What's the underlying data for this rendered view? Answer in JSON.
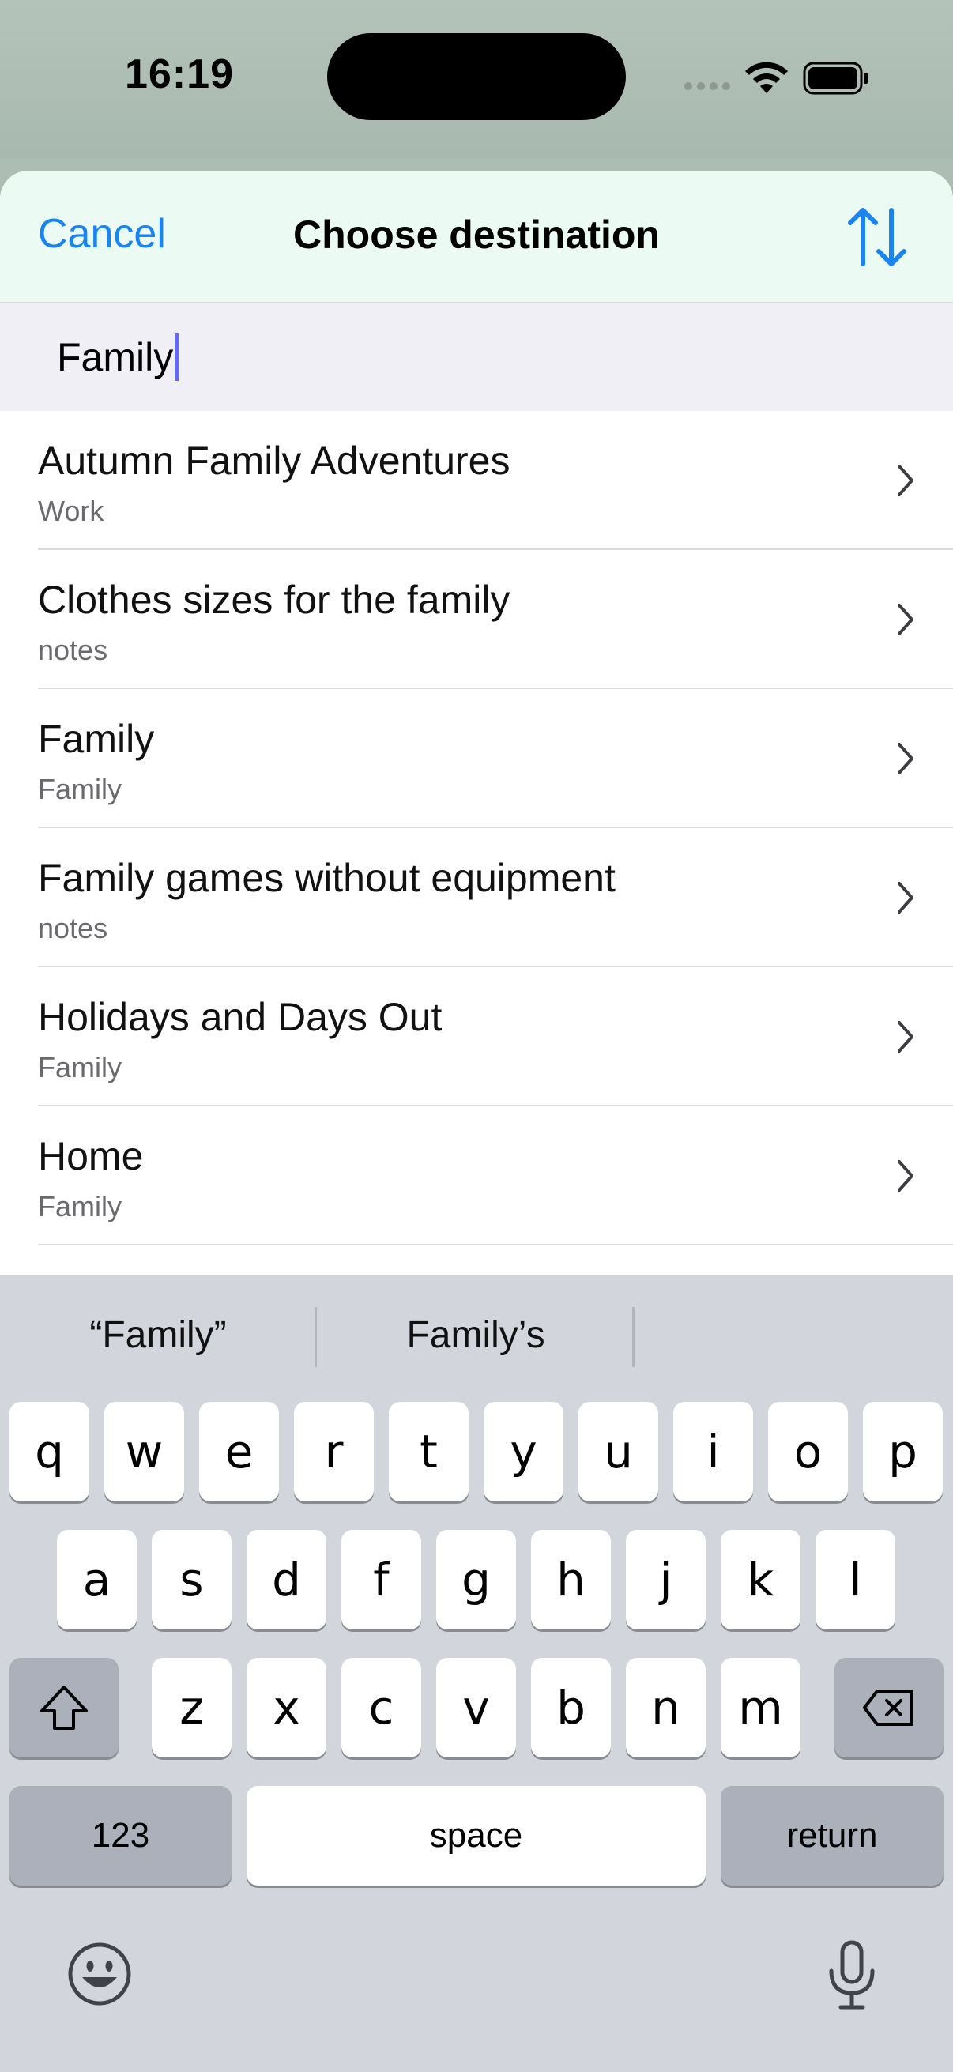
{
  "status": {
    "time": "16:19"
  },
  "nav": {
    "cancel": "Cancel",
    "title": "Choose destination",
    "sort_icon": "sort-arrows-icon"
  },
  "search": {
    "value": "Family"
  },
  "rows": [
    {
      "title": "Autumn Family Adventures",
      "subtitle": "Work"
    },
    {
      "title": "Clothes sizes for the family",
      "subtitle": "notes"
    },
    {
      "title": "Family",
      "subtitle": "Family"
    },
    {
      "title": "Family games without equipment",
      "subtitle": "notes"
    },
    {
      "title": "Holidays and Days Out",
      "subtitle": "Family"
    },
    {
      "title": "Home",
      "subtitle": "Family"
    }
  ],
  "keyboard": {
    "suggestions": [
      "“Family”",
      "Family’s"
    ],
    "row1": [
      "q",
      "w",
      "e",
      "r",
      "t",
      "y",
      "u",
      "i",
      "o",
      "p"
    ],
    "row2": [
      "a",
      "s",
      "d",
      "f",
      "g",
      "h",
      "j",
      "k",
      "l"
    ],
    "row3": [
      "z",
      "x",
      "c",
      "v",
      "b",
      "n",
      "m"
    ],
    "numbers": "123",
    "space": "space",
    "return": "return"
  },
  "colors": {
    "accent": "#1a84f0",
    "nav_bg": "#ebfbf4",
    "keyboard_bg": "#d2d5dc"
  }
}
